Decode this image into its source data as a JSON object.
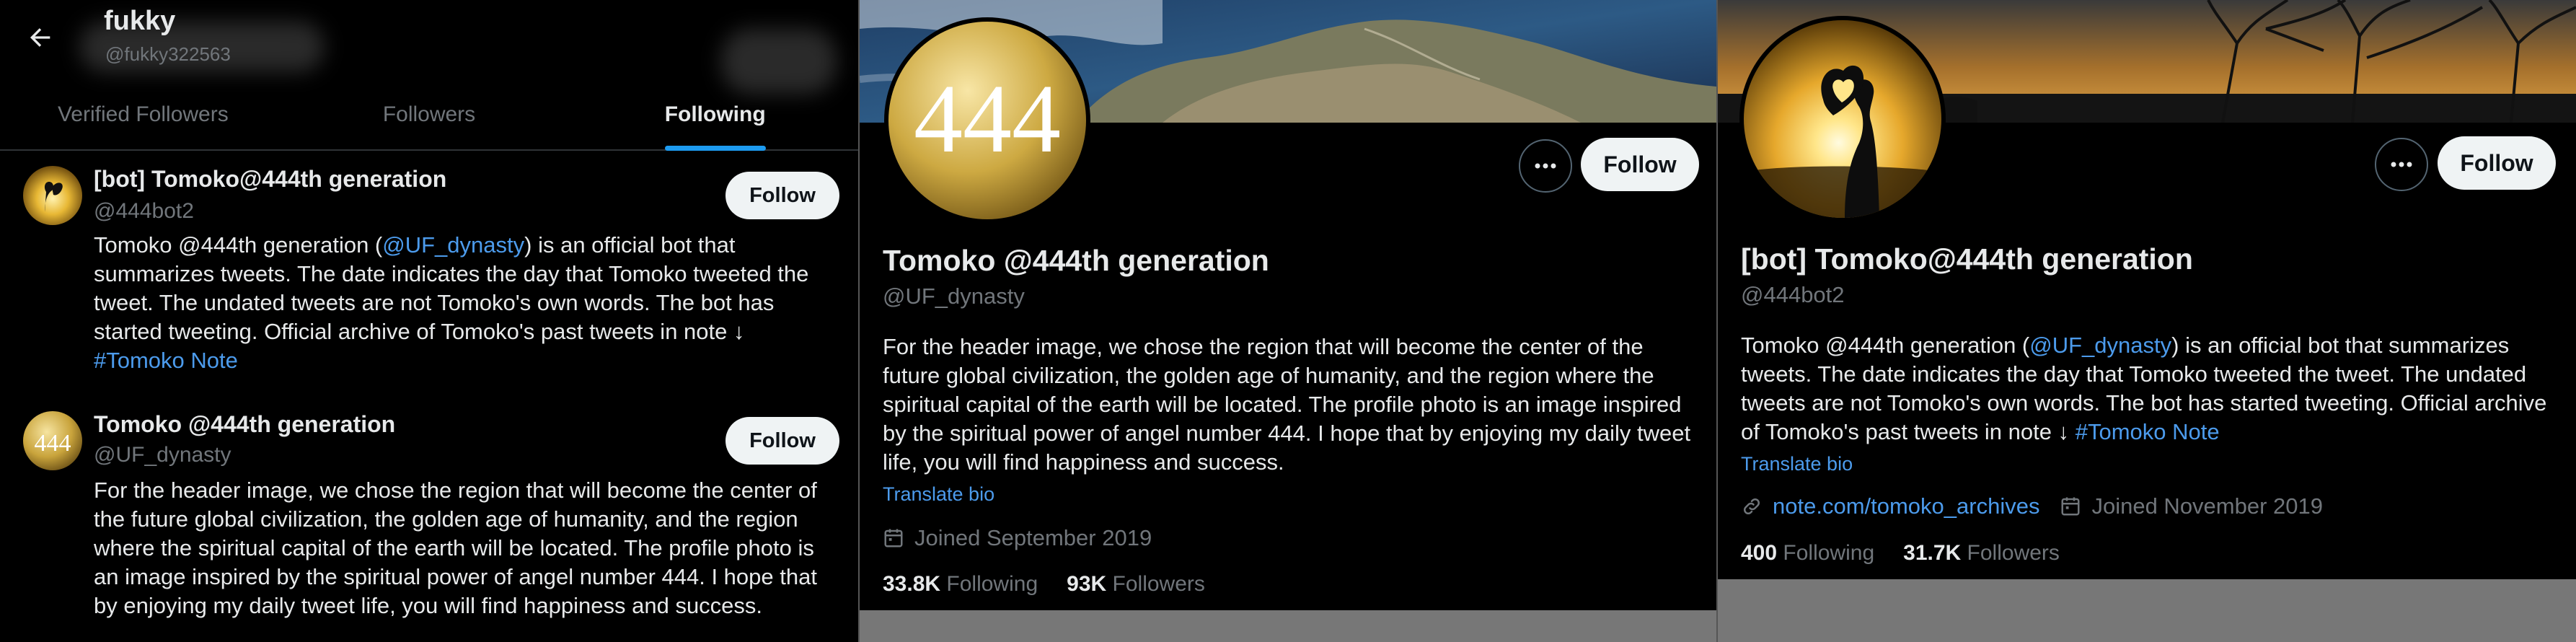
{
  "panel1": {
    "header": {
      "name": "fukky",
      "handle": "@fukky322563"
    },
    "tabs": [
      {
        "label": "Verified Followers",
        "active": false
      },
      {
        "label": "Followers",
        "active": false
      },
      {
        "label": "Following",
        "active": true
      }
    ],
    "users": [
      {
        "name": "[bot] Tomoko@444th generation",
        "handle": "@444bot2",
        "bio_pre": "Tomoko @444th generation (",
        "bio_mention": "@UF_dynasty",
        "bio_post": ") is an official bot that summarizes tweets. The date indicates the day that Tomoko tweeted the tweet. The undated tweets are not Tomoko's own words. The bot has started tweeting. Official archive of Tomoko's past tweets in note ↓",
        "bio_tag": "#Tomoko Note",
        "button": "Follow"
      },
      {
        "name": "Tomoko @444th generation",
        "handle": "@UF_dynasty",
        "bio": "For the header image, we chose the region that will become the center of the future global civilization, the golden age of humanity, and the region where the spiritual capital of the earth will be located. The profile photo is an image inspired by the spiritual power of angel number 444. I hope that by enjoying my daily tweet life, you will find happiness and success.",
        "button": "Follow"
      }
    ]
  },
  "panel2": {
    "avatar_text": "444",
    "name": "Tomoko @444th generation",
    "handle": "@UF_dynasty",
    "bio": "For the header image, we chose the region that will become the center of the future global civilization, the golden age of humanity, and the region where the spiritual capital of the earth will be located. The profile photo is an image inspired by the spiritual power of angel number 444. I hope that by enjoying my daily tweet life, you will find happiness and success.",
    "translate": "Translate bio",
    "joined": "Joined September 2019",
    "following_count": "33.8K",
    "following_label": "Following",
    "followers_count": "93K",
    "followers_label": "Followers",
    "button": "Follow"
  },
  "panel3": {
    "name": "[bot] Tomoko@444th generation",
    "handle": "@444bot2",
    "bio_pre": "Tomoko @444th generation (",
    "bio_mention": "@UF_dynasty",
    "bio_post": ") is an official bot that summarizes tweets. The date indicates the day that Tomoko tweeted the tweet. The undated tweets are not Tomoko's own words. The bot has started tweeting. Official archive of Tomoko's past tweets in note ↓",
    "bio_tag": "#Tomoko Note",
    "translate": "Translate bio",
    "link": "note.com/tomoko_archives",
    "joined": "Joined November 2019",
    "following_count": "400",
    "following_label": "Following",
    "followers_count": "31.7K",
    "followers_label": "Followers",
    "button": "Follow"
  },
  "colors": {
    "accent": "#1d9bf0",
    "link": "#4c9bec",
    "muted": "#71767b",
    "text": "#e7e9ea",
    "gold": "#c9a43c"
  },
  "icons": [
    "back-arrow-icon",
    "more-dots-icon",
    "calendar-icon",
    "link-icon"
  ]
}
